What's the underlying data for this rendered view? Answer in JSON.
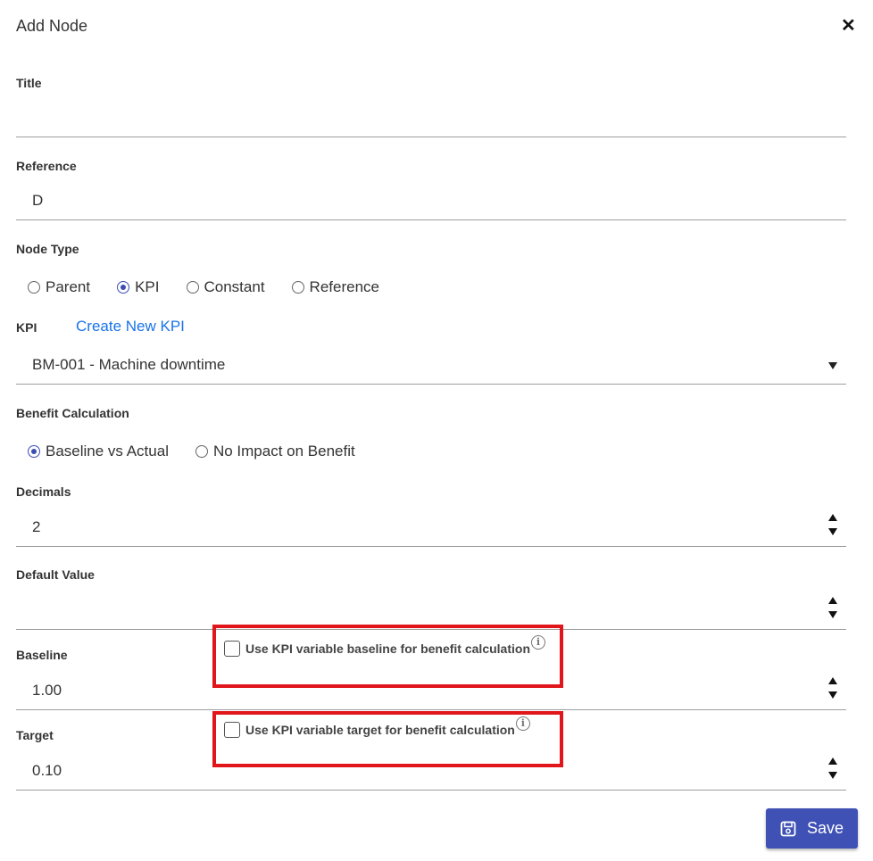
{
  "dialog": {
    "title": "Add Node",
    "close_glyph": "✕"
  },
  "title_field": {
    "label": "Title",
    "value": ""
  },
  "reference_field": {
    "label": "Reference",
    "value": "D"
  },
  "node_type": {
    "label": "Node Type",
    "options": [
      {
        "label": "Parent",
        "selected": false
      },
      {
        "label": "KPI",
        "selected": true
      },
      {
        "label": "Constant",
        "selected": false
      },
      {
        "label": "Reference",
        "selected": false
      }
    ]
  },
  "kpi": {
    "label": "KPI",
    "create_link": "Create New KPI",
    "selected": "BM-001 - Machine downtime"
  },
  "benefit_calc": {
    "label": "Benefit Calculation",
    "options": [
      {
        "label": "Baseline vs Actual",
        "selected": true
      },
      {
        "label": "No Impact on Benefit",
        "selected": false
      }
    ]
  },
  "decimals": {
    "label": "Decimals",
    "value": "2"
  },
  "default_value": {
    "label": "Default Value",
    "value": ""
  },
  "baseline": {
    "label": "Baseline",
    "value": "1.00",
    "checkbox_label": "Use KPI variable baseline for benefit calculation",
    "checked": false
  },
  "target": {
    "label": "Target",
    "value": "0.10",
    "checkbox_label": "Use KPI variable target for benefit calculation",
    "checked": false
  },
  "info_glyph": "i",
  "save_button": {
    "label": "Save",
    "icon": "floppy-disk-icon"
  },
  "colors": {
    "primary": "#3f51b5",
    "highlight": "#e0161b",
    "link": "#1a73e8"
  }
}
